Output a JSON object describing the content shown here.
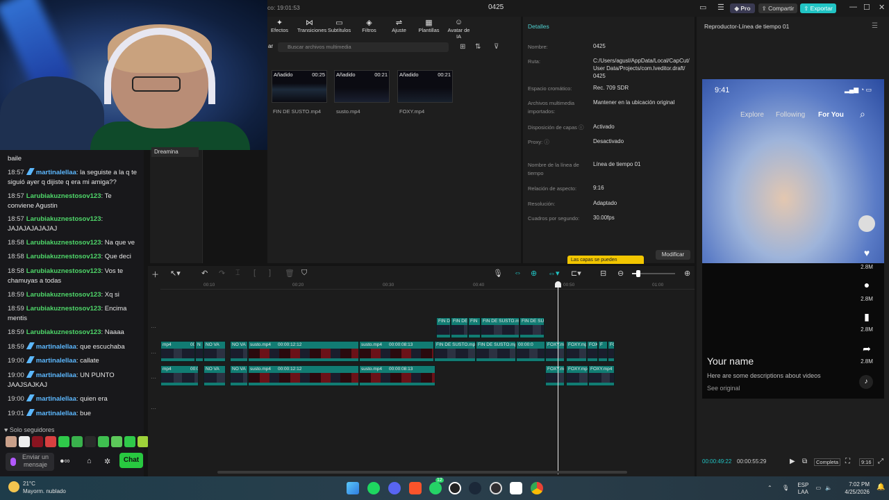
{
  "editor": {
    "top_time": "co: 19:01:53",
    "project_name": "0425",
    "pro_label": "Pro",
    "share_label": "Compartir",
    "export_label": "Exportar",
    "tabs": [
      {
        "label": "Efectos",
        "icon": "effects-icon",
        "glyph": "✦"
      },
      {
        "label": "Transiciones",
        "icon": "transition-icon",
        "glyph": "⋈"
      },
      {
        "label": "Subtítulos",
        "icon": "subtitle-icon",
        "glyph": "▭"
      },
      {
        "label": "Filtros",
        "icon": "filter-icon",
        "glyph": "◈"
      },
      {
        "label": "Ajuste",
        "icon": "adjust-icon",
        "glyph": "⇌"
      },
      {
        "label": "Plantillas",
        "icon": "template-icon",
        "glyph": "▦"
      },
      {
        "label": "Avatar de IA",
        "icon": "ai-avatar-icon",
        "glyph": "☺"
      }
    ],
    "search_placeholder": "Buscar archivos multimedia",
    "side_item": "Dreamina",
    "media_clips": [
      {
        "tag": "Añadido",
        "duration": "00:25",
        "name": "FIN DE SUSTO.mp4"
      },
      {
        "tag": "Añadido",
        "duration": "00:21",
        "name": "susto.mp4"
      },
      {
        "tag": "Añadido",
        "duration": "00:21",
        "name": "FOXY.mp4"
      }
    ]
  },
  "details": {
    "title": "Detalles",
    "rows": [
      {
        "label": "Nombre:",
        "value": "0425"
      },
      {
        "label": "Ruta:",
        "value": "C:/Users/agusl/AppData/Local/CapCut/ User Data/Projects/com.lveditor.draft/ 0425"
      },
      {
        "label": "Espacio cromático:",
        "value": "Rec. 709 SDR"
      },
      {
        "label": "Archivos multimedia importados:",
        "value": "Mantener en la ubicación original"
      },
      {
        "label": "Disposición de capas ⓘ",
        "value": "Activado"
      },
      {
        "label": "Proxy: ⓘ",
        "value": "Desactivado"
      },
      {
        "label": "Nombre de la línea de tiempo",
        "value": "Línea de tiempo 01"
      },
      {
        "label": "Relación de aspecto:",
        "value": "9:16"
      },
      {
        "label": "Resolución:",
        "value": "Adaptado"
      },
      {
        "label": "Cuadros por segundo:",
        "value": "30.00fps"
      }
    ],
    "layer_tip": "Las capas se pueden",
    "modify_label": "Modificar"
  },
  "player": {
    "title": "Reproductor-Línea de tiempo 01",
    "phone_time": "9:41",
    "nav": [
      "Explore",
      "Following",
      "For You"
    ],
    "counts": [
      "2.8M",
      "2.8M",
      "2.8M",
      "2.8M"
    ],
    "name": "Your name",
    "description": "Here are some descriptions about videos",
    "see_original": "See original",
    "current_time": "00:00:49:22",
    "total_time": "00:00:55:29",
    "complete_label": "Completa",
    "ratio_label": "9:16"
  },
  "timeline": {
    "ticks": [
      "00:10",
      "00:20",
      "00:30",
      "00:40",
      "00:50",
      "01:00"
    ],
    "top_row": [
      "FIN D",
      "FIN DE",
      "FIN",
      "FIN DE SUSTO.m",
      "FIN DE SUS"
    ],
    "mid_row": [
      "mp4",
      "00:00:0",
      "N",
      "NO VA",
      "NO VA",
      "susto.mp4",
      "00:00:12:12",
      "susto.mp4",
      "00:00:08:13",
      "FIN DE SUSTO.mp",
      "FIN DE SUSTO.mp",
      "00:00:0",
      "FOXY.mp",
      "FOXY.mp",
      "FOX",
      "F",
      "FOI"
    ],
    "bottom_row": [
      "mp4",
      "00:00:0",
      "NO VA",
      "NO VA",
      "susto.mp4",
      "00:00:12:12",
      "susto.mp4",
      "00:00:08:13",
      "FOXY.mp",
      "FOXY.mp4",
      "FOXY.mp4"
    ]
  },
  "chat": {
    "first_line": "baile",
    "messages": [
      {
        "time": "18:57",
        "user": "martinalellaa",
        "badge": true,
        "color": "blue",
        "text": "la seguiste a la q te siguió ayer q dijiste q era mi amiga??"
      },
      {
        "time": "18:57",
        "user": "Larubiakuznestosov123",
        "badge": false,
        "color": "green",
        "text": "Te conviene Agustin"
      },
      {
        "time": "18:57",
        "user": "Larubiakuznestosov123",
        "badge": false,
        "color": "green",
        "text": "JAJAJAJAJAJAJ"
      },
      {
        "time": "18:58",
        "user": "Larubiakuznestosov123",
        "badge": false,
        "color": "green",
        "text": "Na que ve"
      },
      {
        "time": "18:58",
        "user": "Larubiakuznestosov123",
        "badge": false,
        "color": "green",
        "text": "Que deci"
      },
      {
        "time": "18:58",
        "user": "Larubiakuznestosov123",
        "badge": false,
        "color": "green",
        "text": "Vos te chamuyas a todas"
      },
      {
        "time": "18:59",
        "user": "Larubiakuznestosov123",
        "badge": false,
        "color": "green",
        "text": "Xq si"
      },
      {
        "time": "18:59",
        "user": "Larubiakuznestosov123",
        "badge": false,
        "color": "green",
        "text": "Encima mentis"
      },
      {
        "time": "18:59",
        "user": "Larubiakuznestosov123",
        "badge": false,
        "color": "green",
        "text": "Naaaa"
      },
      {
        "time": "18:59",
        "user": "martinalellaa",
        "badge": true,
        "color": "blue",
        "text": "que escuchaba"
      },
      {
        "time": "19:00",
        "user": "martinalellaa",
        "badge": true,
        "color": "blue",
        "text": "callate"
      },
      {
        "time": "19:00",
        "user": "martinalellaa",
        "badge": true,
        "color": "blue",
        "text": "UN PUNTO JAAJSAJKAJ"
      },
      {
        "time": "19:00",
        "user": "martinalellaa",
        "badge": true,
        "color": "blue",
        "text": "quien era"
      },
      {
        "time": "19:01",
        "user": "martinalellaa",
        "badge": true,
        "color": "blue",
        "text": "bue"
      }
    ],
    "followers_only": "Solo seguidores",
    "send_placeholder": "Enviar un mensaje",
    "chat_button": "Chat"
  },
  "taskbar": {
    "temperature": "21°C",
    "weather": "Mayorm. nublado",
    "lang": "ESP",
    "lang2": "LAA",
    "time": "7:02 PM",
    "date": "4/25/2026",
    "whatsapp_badge": "12"
  },
  "colors": {
    "accent": "#21c4c4",
    "clip_teal": "#117c73",
    "chat_green": "#4fd86a",
    "chat_blue": "#5cb8ff",
    "chat_button": "#28c840"
  }
}
